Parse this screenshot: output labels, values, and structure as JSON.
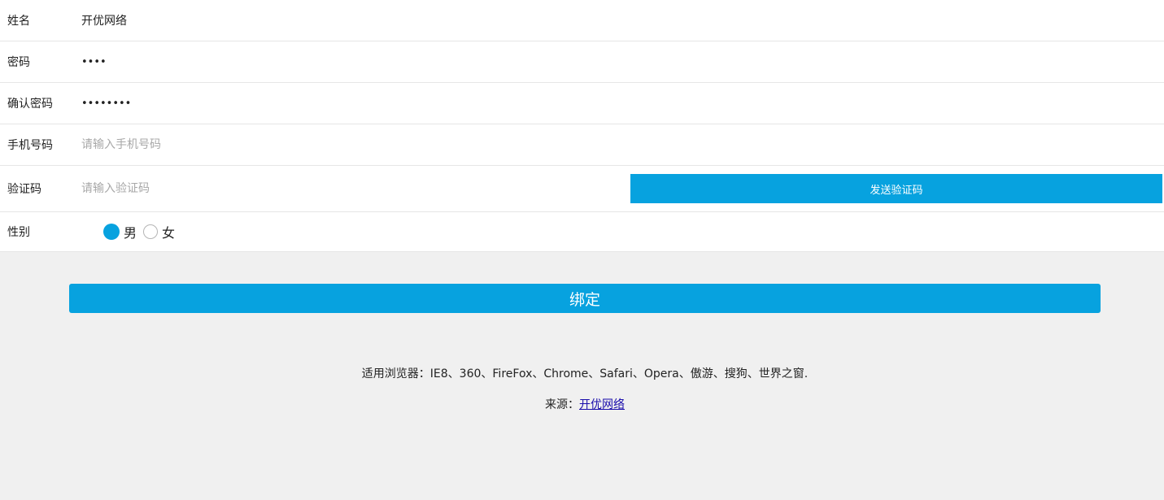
{
  "form": {
    "name": {
      "label": "姓名",
      "value": "开优网络"
    },
    "password": {
      "label": "密码",
      "value": "abcd"
    },
    "confirm": {
      "label": "确认密码",
      "value": "abcdefgh"
    },
    "phone": {
      "label": "手机号码",
      "placeholder": "请输入手机号码"
    },
    "code": {
      "label": "验证码",
      "placeholder": "请输入验证码",
      "send_label": "发送验证码"
    },
    "gender": {
      "label": "性别",
      "options": [
        "男",
        "女"
      ],
      "selected": "男"
    }
  },
  "submit_label": "绑定",
  "footer": {
    "browsers": "适用浏览器：IE8、360、FireFox、Chrome、Safari、Opera、傲游、搜狗、世界之窗.",
    "source_prefix": "来源：",
    "source_link": "开优网络"
  },
  "colors": {
    "accent": "#07a2df",
    "background": "#f0f0f0"
  }
}
